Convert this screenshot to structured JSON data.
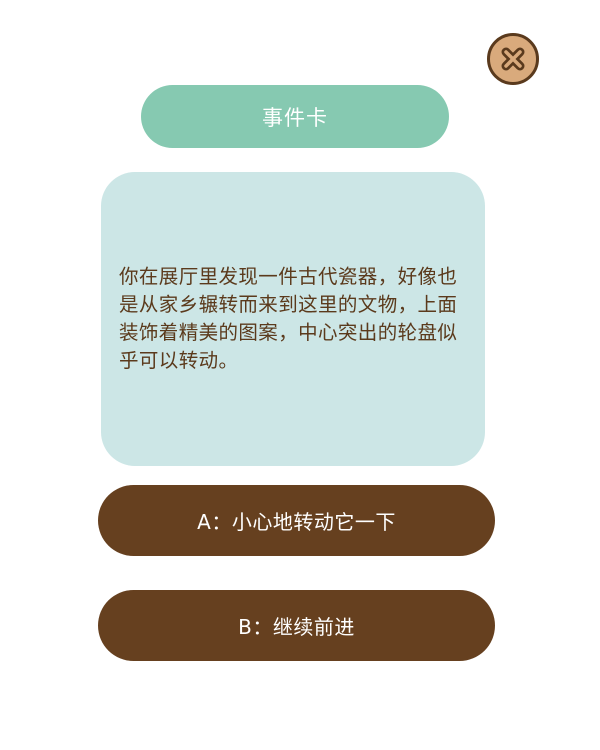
{
  "close": {
    "icon": "close-icon",
    "colors": {
      "fill": "#d9aa7c",
      "outline": "#5a3a1d"
    }
  },
  "header": {
    "title": "事件卡",
    "color": "#86c9b1"
  },
  "story": {
    "text": "你在展厅里发现一件古代瓷器，好像也是从家乡辗转而来到这里的文物，上面装饰着精美的图案，中心突出的轮盘似乎可以转动。",
    "background": "#cce6e6",
    "text_color": "#5b3a1c"
  },
  "choices": [
    {
      "label": "A：小心地转动它一下"
    },
    {
      "label": "B：继续前进"
    }
  ],
  "theme": {
    "choice_color": "#66401f"
  }
}
